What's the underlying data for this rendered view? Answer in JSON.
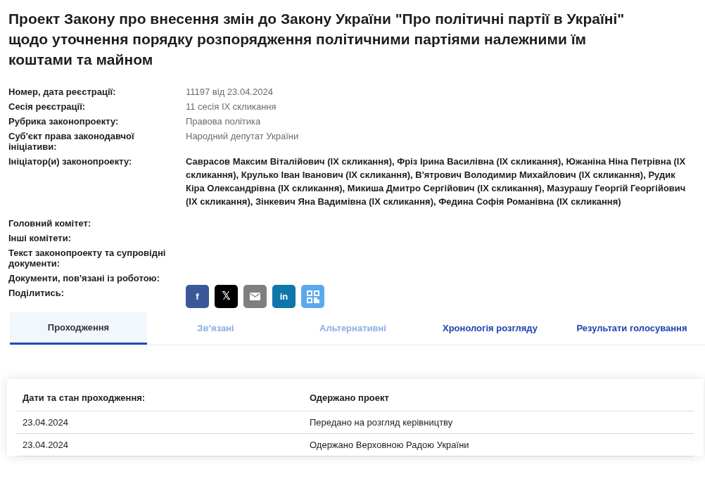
{
  "title": "Проект Закону про внесення змін до Закону України \"Про політичні партії в Україні\" щодо уточнення порядку розпорядження політичними партіями належними їм коштами та майном",
  "details": [
    {
      "label": "Номер, дата реєстрації:",
      "value": "11197 від 23.04.2024",
      "kind": "plain"
    },
    {
      "label": "Сесія реєстрації:",
      "value": "11 сесія IX скликання",
      "kind": "plain"
    },
    {
      "label": "Рубрика законопроекту:",
      "value": "Правова політика",
      "kind": "plain"
    },
    {
      "label": "Суб'єкт права законодавчої ініціативи:",
      "value": "Народний депутат України",
      "kind": "plain"
    },
    {
      "label": "Ініціатор(и) законопроекту:",
      "value": "Саврасов Максим Віталійович (IX скликання), Фріз Ірина Василівна (IX скликання), Южаніна Ніна Петрівна (IX скликання), Крулько Іван Іванович (IX скликання), В'ятрович Володимир Михайлович (IX скликання), Рудик Кіра Олександрівна (IX скликання), Микиша Дмитро Сергійович (IX скликання), Мазурашу Георгій Георгійович (IX скликання), Зінкевич Яна Вадимівна (IX скликання), Федина Софія Романівна (IX скликання)",
      "kind": "bold"
    },
    {
      "label": "Головний комітет:"
    },
    {
      "label": "Інші комітети:"
    },
    {
      "label": "Текст законопроекту та супровідні документи:"
    },
    {
      "label": "Документи, пов'язані із роботою:"
    },
    {
      "label": "Поділитись:",
      "kind": "share"
    }
  ],
  "share_buttons": [
    {
      "kind": "facebook",
      "text": "f"
    },
    {
      "kind": "x",
      "text": "𝕏"
    },
    {
      "kind": "email"
    },
    {
      "kind": "linkedin",
      "text": "in"
    },
    {
      "kind": "qr"
    }
  ],
  "tabs": [
    {
      "label": "Проходження",
      "selected": true,
      "disabled": false
    },
    {
      "label": "Зв’язані",
      "selected": false,
      "disabled": true
    },
    {
      "label": "Альтернативні",
      "selected": false,
      "disabled": true
    },
    {
      "label": "Хронологія розгляду",
      "selected": false,
      "disabled": false
    },
    {
      "label": "Результати голосування",
      "selected": false,
      "disabled": false
    }
  ],
  "table": {
    "columns": [
      "Дати та стан проходження:",
      "Одержано проект"
    ],
    "rows": [
      [
        "23.04.2024",
        "Передано на розгляд керівництву"
      ],
      [
        "23.04.2024",
        "Одержано Верховною Радою України"
      ]
    ]
  }
}
